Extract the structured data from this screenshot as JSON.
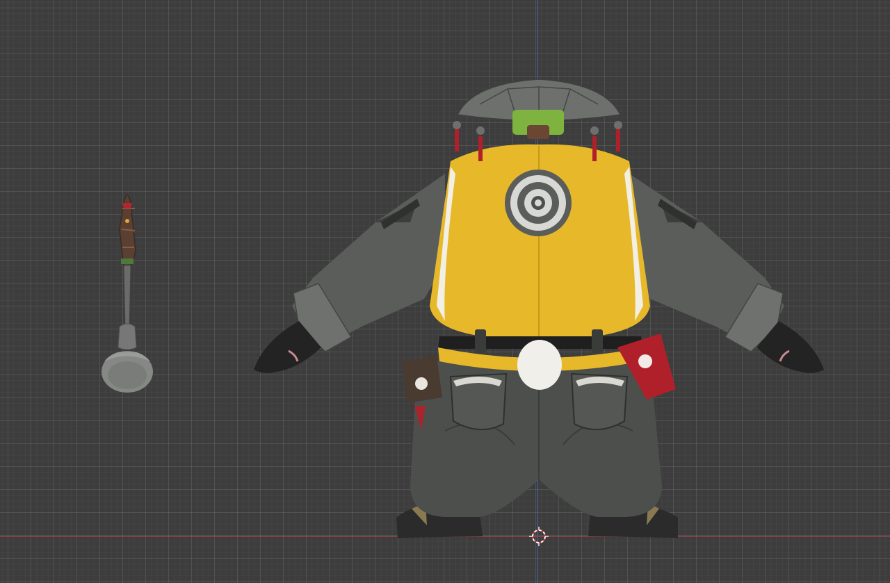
{
  "viewport": {
    "mode": "front-orthographic",
    "grid": true,
    "background_color": "#3d3d3d",
    "x_axis_color": "#b8434f",
    "z_axis_color": "#3d6ab0"
  },
  "scene_objects": [
    {
      "name": "ladle",
      "icon": "ladle-model"
    },
    {
      "name": "character",
      "icon": "panda-character-model"
    },
    {
      "name": "3d-cursor",
      "icon": "crosshair-cursor-icon"
    }
  ],
  "colors": {
    "vest_yellow": "#e7b92a",
    "coat_gray": "#5a5d5a",
    "pants_gray": "#4c4f4c",
    "hat_gray": "#6d706d",
    "tassel_red": "#b0202a",
    "fur_black": "#232323"
  }
}
